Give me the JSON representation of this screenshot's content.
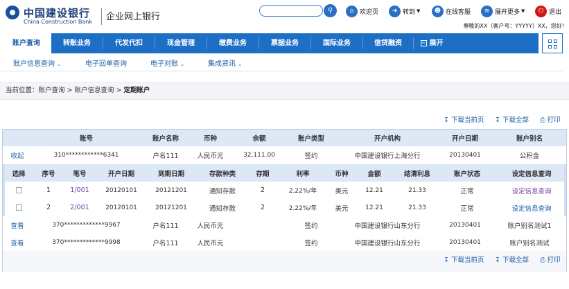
{
  "header": {
    "bank_name": "中国建设银行",
    "bank_name_en": "China Construction Bank",
    "system_name": "企业网上银行",
    "links": [
      "欢迎页",
      "转到",
      "在线客服",
      "展开更多",
      "退出"
    ],
    "welcome": "尊敬的XX（客户号：YYYYY）XX，您好!"
  },
  "nav": {
    "tabs": [
      "账户查询",
      "转账业务",
      "代发代扣",
      "现金管理",
      "缴费业务",
      "票据业务",
      "国际业务",
      "信贷融资",
      "展开"
    ]
  },
  "subnav": {
    "items": [
      "账户信息查询",
      "电子回单查询",
      "电子对账",
      "集成资讯"
    ]
  },
  "breadcrumb": {
    "prefix": "当前位置：账户查询 > 账户信息查询 > ",
    "current": "定期账户"
  },
  "toolbar": {
    "download_page": "下载当前页",
    "download_all": "下载全部",
    "print": "打印"
  },
  "table": {
    "headers": [
      "账号",
      "账户名称",
      "币种",
      "余额",
      "账户类型",
      "开户机构",
      "开户日期",
      "账户别名"
    ],
    "rows": [
      {
        "action": "收起",
        "account": "310************6341",
        "name": "户名111",
        "currency": "人民币元",
        "balance": "32,111.00",
        "type": "签约",
        "branch": "中国建设银行上海分行",
        "date": "20130401",
        "alias": "公积金"
      },
      {
        "action": "查看",
        "account": "370*************9967",
        "name": "户名111",
        "currency": "人民币元",
        "balance": "",
        "type": "签约",
        "branch": "中国建设银行山东分行",
        "date": "20130401",
        "alias": "账户别名测试1"
      },
      {
        "action": "查看",
        "account": "370*************9998",
        "name": "户名111",
        "currency": "人民币元",
        "balance": "",
        "type": "签约",
        "branch": "中国建设银行山东分行",
        "date": "20130401",
        "alias": "账户别名测试"
      }
    ],
    "sub_headers": [
      "选择",
      "序号",
      "笔号",
      "开户日期",
      "到期日期",
      "存款种类",
      "存期",
      "利率",
      "币种",
      "金额",
      "结清利息",
      "账户状态",
      "设定信息查询"
    ],
    "sub_rows": [
      {
        "seq": "1",
        "no": "1/001",
        "open": "20120101",
        "due": "20121201",
        "kind": "通知存款",
        "term": "2",
        "rate": "2.22%/年",
        "currency": "美元",
        "amount": "12.21",
        "interest": "21.33",
        "status": "正常",
        "action": "设定信息查询"
      },
      {
        "seq": "2",
        "no": "2/001",
        "open": "20120101",
        "due": "20121201",
        "kind": "通知存款",
        "term": "2",
        "rate": "2.22%/年",
        "currency": "美元",
        "amount": "12.21",
        "interest": "21.33",
        "status": "正常",
        "action": "设定信息查询"
      }
    ]
  },
  "colors": {
    "primary": "#1d6fc5",
    "header_bg": "#dce8f6",
    "logo": "#1a4fa0",
    "exit": "#d01818"
  }
}
